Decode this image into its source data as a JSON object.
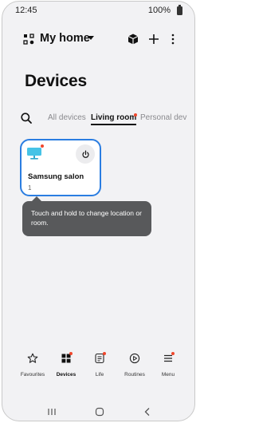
{
  "status_bar": {
    "time": "12:45",
    "battery": "100%"
  },
  "header": {
    "home_name": "My home"
  },
  "page": {
    "title": "Devices"
  },
  "tabs": [
    {
      "label": "All devices",
      "active": false
    },
    {
      "label": "Living room",
      "active": true,
      "badge": true
    },
    {
      "label": "Personal dev",
      "active": false
    }
  ],
  "device_card": {
    "name": "Samsung salon",
    "count": "1",
    "icon": "tv-icon",
    "selected": true
  },
  "tooltip": {
    "text": "Touch and hold to change location or room."
  },
  "bottom_nav": [
    {
      "label": "Favourites",
      "icon": "star-icon",
      "active": false,
      "badge": false
    },
    {
      "label": "Devices",
      "icon": "devices-grid-icon",
      "active": true,
      "badge": true
    },
    {
      "label": "Life",
      "icon": "life-icon",
      "active": false,
      "badge": true
    },
    {
      "label": "Routines",
      "icon": "play-circle-icon",
      "active": false,
      "badge": false
    },
    {
      "label": "Menu",
      "icon": "menu-icon",
      "active": false,
      "badge": true
    }
  ],
  "colors": {
    "accent": "#2a7de1",
    "badge": "#f0472c",
    "tooltip_bg": "#58595b",
    "screen_bg": "#f2f2f4"
  }
}
